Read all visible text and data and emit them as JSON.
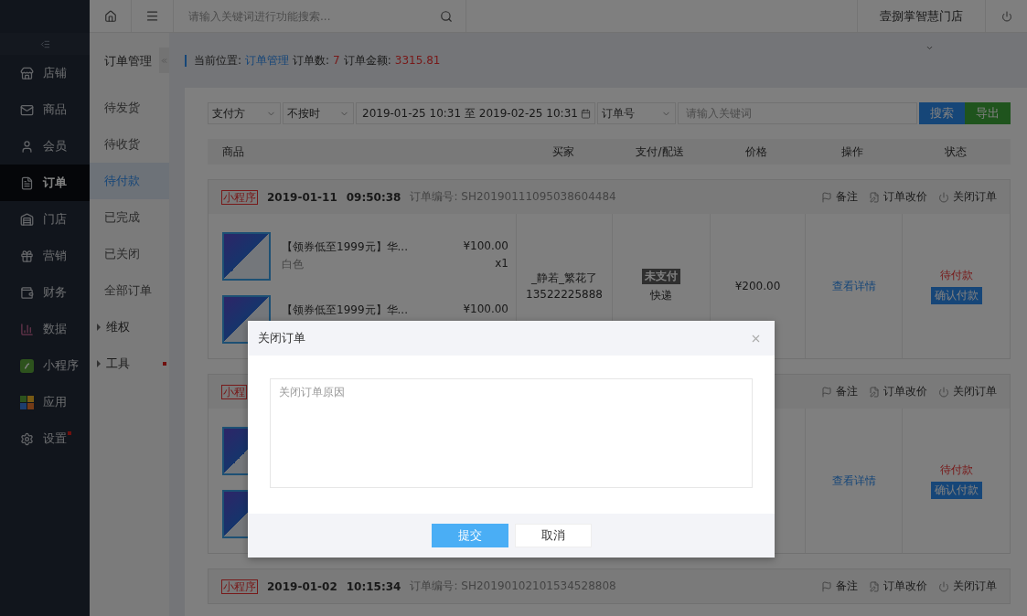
{
  "sidebar": {
    "items": [
      {
        "kind": "store",
        "label": "店铺",
        "selected": false,
        "badge": false
      },
      {
        "kind": "goods",
        "label": "商品",
        "selected": false,
        "badge": false
      },
      {
        "kind": "member",
        "label": "会员",
        "selected": false,
        "badge": false
      },
      {
        "kind": "order",
        "label": "订单",
        "selected": true,
        "badge": false
      },
      {
        "kind": "shop",
        "label": "门店",
        "selected": false,
        "badge": false
      },
      {
        "kind": "marketing",
        "label": "营销",
        "selected": false,
        "badge": false
      },
      {
        "kind": "finance",
        "label": "财务",
        "selected": false,
        "badge": false
      },
      {
        "kind": "data",
        "label": "数据",
        "selected": false,
        "badge": false
      },
      {
        "kind": "miniapp",
        "label": "小程序",
        "selected": false,
        "badge": false
      },
      {
        "kind": "apps",
        "label": "应用",
        "selected": false,
        "badge": false
      },
      {
        "kind": "settings",
        "label": "设置",
        "selected": false,
        "badge": true
      }
    ]
  },
  "topbar": {
    "search_placeholder": "请输入关键词进行功能搜索...",
    "store": "壹捌掌智慧门店"
  },
  "subnav": {
    "title": "订单管理",
    "items": [
      {
        "kind": "link",
        "label": "待发货",
        "selected": false
      },
      {
        "kind": "link",
        "label": "待收货",
        "selected": false
      },
      {
        "kind": "link",
        "label": "待付款",
        "selected": true
      },
      {
        "kind": "link",
        "label": "已完成",
        "selected": false
      },
      {
        "kind": "link",
        "label": "已关闭",
        "selected": false
      },
      {
        "kind": "link",
        "label": "全部订单",
        "selected": false
      },
      {
        "kind": "group",
        "label": "维权",
        "selected": false,
        "badge": false
      },
      {
        "kind": "group",
        "label": "工具",
        "selected": false,
        "badge": true
      }
    ]
  },
  "breadcrumb": {
    "label": "当前位置:",
    "current": "订单管理",
    "count_label": "订单数:",
    "count": "7",
    "amount_label": "订单金额:",
    "amount": "3315.81"
  },
  "filters": {
    "pay_method": "支付方",
    "time_mode": "不按时",
    "date_range": "2019-01-25 10:31 至 2019-02-25 10:31",
    "field": "订单号",
    "placeholder": "请输入关键词",
    "search": "搜索",
    "export": "导出"
  },
  "columns": [
    "商品",
    "买家",
    "支付/配送",
    "价格",
    "操作",
    "状态"
  ],
  "orders": [
    {
      "kind": "full",
      "tag": "小程序",
      "date": "2019-01-11",
      "time": "09:50:38",
      "number_label": "订单编号:",
      "number": "SH20190111095038604484",
      "actions": [
        "备注",
        "订单改价",
        "关闭订单"
      ],
      "items": [
        {
          "name": "【领券低至1999元】华...",
          "spec": "白色",
          "price": "¥100.00",
          "qty": "x1"
        },
        {
          "name": "【领券低至1999元】华...",
          "price": "¥100.00"
        }
      ],
      "buyer": "_静若_繁花了",
      "phone": "13522225888",
      "pay_status": "未支付",
      "delivery": "快递",
      "total": "¥200.00",
      "detail": "查看详情",
      "status": "待付款",
      "confirm": "确认付款"
    },
    {
      "kind": "partial",
      "tag": "小程",
      "actions": [
        "备注",
        "订单改价",
        "关闭订单"
      ],
      "detail": "查看详情",
      "status": "待付款",
      "confirm": "确认付款"
    },
    {
      "kind": "header",
      "tag": "小程序",
      "date": "2019-01-02",
      "time": "10:15:34",
      "number_label": "订单编号:",
      "number": "SH20190102101534528808",
      "actions": [
        "备注",
        "订单改价",
        "关闭订单"
      ]
    }
  ],
  "modal": {
    "title": "关闭订单",
    "placeholder": "关闭订单原因",
    "submit": "提交",
    "cancel": "取消"
  }
}
